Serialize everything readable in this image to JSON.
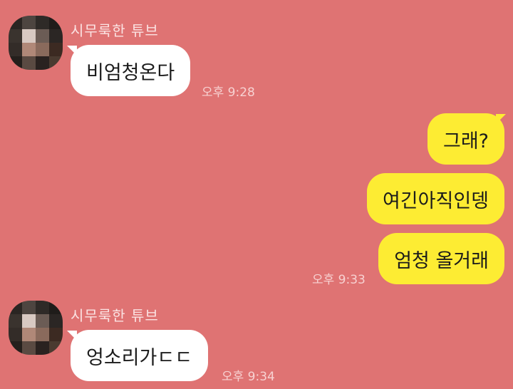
{
  "colors": {
    "background": "#DF7373",
    "incoming_bubble": "#FFFFFF",
    "outgoing_bubble": "#FDEC33",
    "sender_text": "#FBE3E3",
    "time_text": "#F7D2D2"
  },
  "avatar_palette": [
    "#2a2522",
    "#4d4540",
    "#2e2a27",
    "#1f1c1a",
    "#3a332e",
    "#d8c9c2",
    "#6b5c55",
    "#2b2624",
    "#332c28",
    "#b08878",
    "#8a6a5c",
    "#3c2a22",
    "#241f1c",
    "#5a4a42",
    "#2a2220",
    "#4a3a30"
  ],
  "messages": [
    {
      "direction": "in",
      "sender": "시무룩한 튜브",
      "text": "비엄청온다",
      "time": "오후 9:28"
    },
    {
      "direction": "out",
      "text": "그래?"
    },
    {
      "direction": "out",
      "text": "여긴아직인뎅"
    },
    {
      "direction": "out",
      "text": "엄청 올거래",
      "time": "오후 9:33"
    },
    {
      "direction": "in",
      "sender": "시무룩한 튜브",
      "text": "엉소리가ㄷㄷ",
      "time": "오후 9:34"
    }
  ]
}
